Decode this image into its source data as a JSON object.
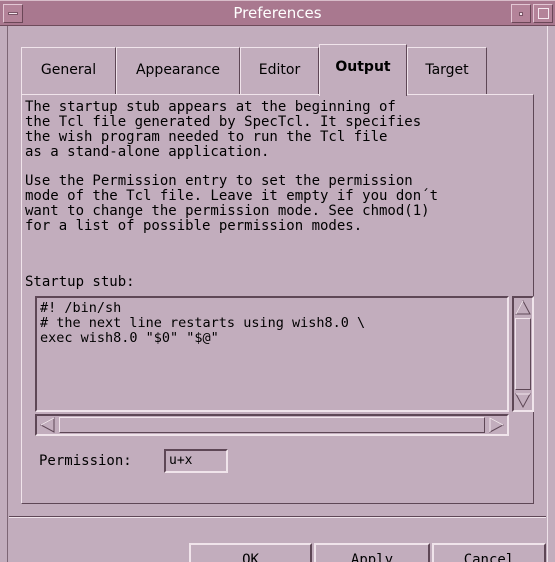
{
  "window": {
    "title": "Preferences"
  },
  "tabs": [
    {
      "label": "General",
      "active": false
    },
    {
      "label": "Appearance",
      "active": false
    },
    {
      "label": "Editor",
      "active": false
    },
    {
      "label": "Output",
      "active": true
    },
    {
      "label": "Target",
      "active": false
    }
  ],
  "output": {
    "description_1": "The startup stub appears at the beginning of\nthe Tcl file generated by SpecTcl. It specifies\nthe wish program needed to run the Tcl file\nas a stand-alone application.",
    "description_2": "Use the Permission entry to set the permission\nmode of the Tcl file. Leave it empty if you don´t\nwant to change the permission mode. See chmod(1)\nfor a list of possible permission modes.",
    "startup_stub_label": "Startup stub:",
    "startup_stub_lines": [
      "#! /bin/sh",
      "# the next line restarts using wish8.0 \\",
      "exec wish8.0 \"$0\" \"$@\""
    ],
    "permission_label": "Permission:",
    "permission_value": "u+x"
  },
  "buttons": {
    "ok": "OK",
    "apply": "Apply",
    "cancel": "Cancel"
  },
  "colors": {
    "background": "#c2adbd",
    "titlebar": "#a9788f"
  }
}
